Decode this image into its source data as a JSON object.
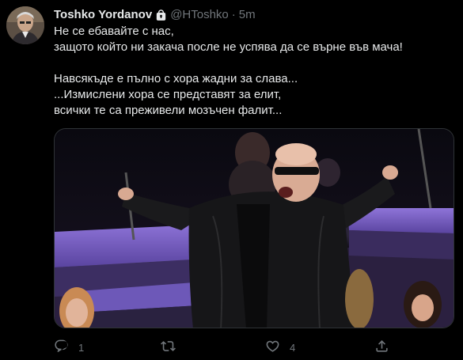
{
  "user": {
    "display_name": "Toshko Yordanov",
    "handle": "@HToshko",
    "separator": "·",
    "timestamp": "5m",
    "protected_icon": "lock-icon"
  },
  "tweet": {
    "lines": [
      "Не се ебавайте с нас,",
      "защото който ни закача после не успява да се върне във мача!",
      "",
      "Навсякъде е пълно с хора жадни за слава...",
      "...Измислени хора се представят за елит,",
      "всички те са преживели мозъчен фалит..."
    ]
  },
  "actions": {
    "reply": {
      "icon": "reply-icon",
      "count": "1"
    },
    "retweet": {
      "icon": "retweet-icon",
      "count": ""
    },
    "like": {
      "icon": "heart-icon",
      "count": "4"
    },
    "share": {
      "icon": "share-icon"
    }
  },
  "colors": {
    "background": "#000000",
    "text": "#e7e9ea",
    "secondary": "#71767b",
    "stage_purple": "#7a5ec8"
  }
}
